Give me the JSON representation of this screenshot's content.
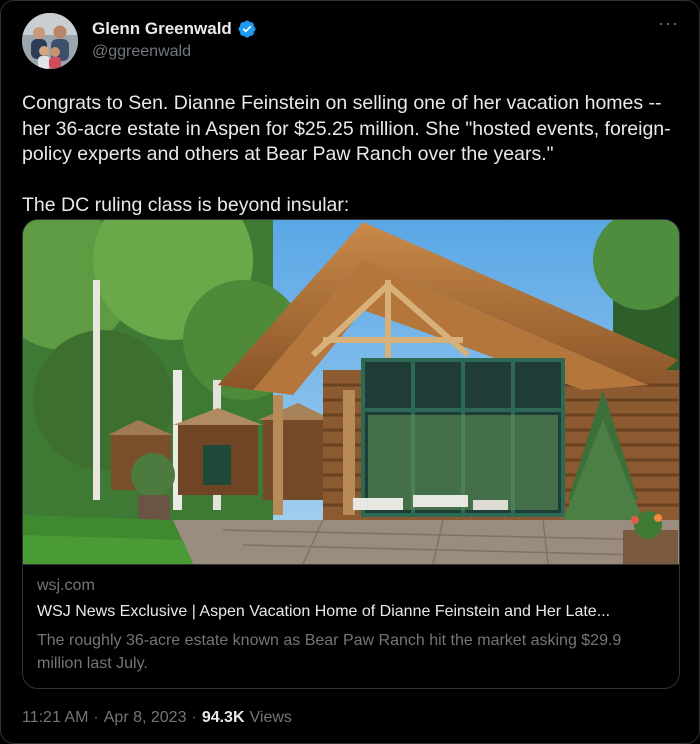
{
  "author": {
    "display_name": "Glenn Greenwald",
    "handle": "@ggreenwald",
    "verified": true
  },
  "tweet": {
    "text": "Congrats to Sen. Dianne Feinstein on selling one of her vacation homes -- her 36-acre estate in Aspen for $25.25 million. She \"hosted events, foreign-policy experts and others at Bear Paw Ranch over the years.\"\n\nThe DC ruling class is beyond insular:"
  },
  "card": {
    "domain": "wsj.com",
    "title": "WSJ News Exclusive | Aspen Vacation Home of Dianne Feinstein and Her Late...",
    "description": "The roughly 36-acre estate known as Bear Paw Ranch hit the market asking $29.9 million last July."
  },
  "meta": {
    "time": "11:21 AM",
    "separator": "·",
    "date": "Apr 8, 2023",
    "views_count": "94.3K",
    "views_label": "Views"
  },
  "icons": {
    "more": "more-options-icon",
    "verified": "verified-badge-icon"
  },
  "colors": {
    "background": "#000000",
    "text_primary": "#e7e9ea",
    "text_secondary": "#71767b",
    "border": "#2f3336",
    "verified_blue": "#1d9bf0"
  }
}
